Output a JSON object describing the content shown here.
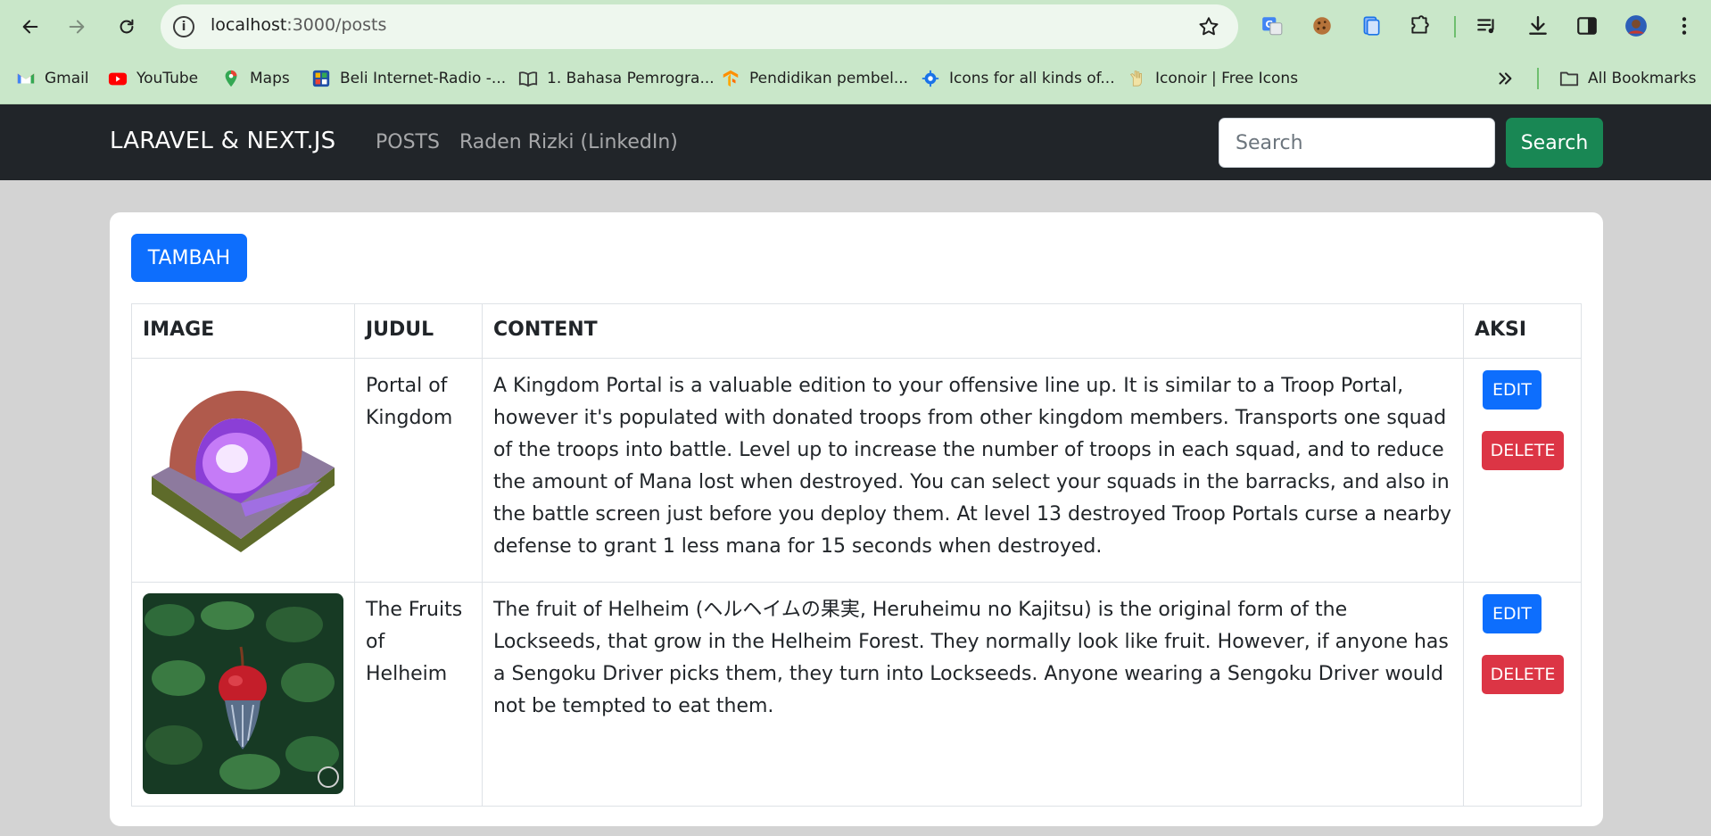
{
  "browser": {
    "url_host": "localhost",
    "url_path": ":3000/posts",
    "bookmarks": [
      {
        "label": "Gmail",
        "icon": "gmail-icon"
      },
      {
        "label": "YouTube",
        "icon": "youtube-icon"
      },
      {
        "label": "Maps",
        "icon": "maps-icon"
      },
      {
        "label": "Beli Internet-Radio -...",
        "icon": "radio-icon"
      },
      {
        "label": "1. Bahasa Pemrogra...",
        "icon": "book-icon"
      },
      {
        "label": "Pendidikan pembel...",
        "icon": "tensorflow-icon"
      },
      {
        "label": "Icons for all kinds of...",
        "icon": "icons-site-icon"
      },
      {
        "label": "Iconoir | Free Icons",
        "icon": "iconoir-icon"
      }
    ],
    "all_bookmarks": "All Bookmarks"
  },
  "navbar": {
    "brand": "LARAVEL & NEXT.JS",
    "links": [
      "POSTS",
      "Raden Rizki (LinkedIn)"
    ],
    "search_placeholder": "Search",
    "search_button": "Search"
  },
  "main": {
    "add_button": "TAMBAH",
    "columns": [
      "IMAGE",
      "JUDUL",
      "CONTENT",
      "AKSI"
    ],
    "rows": [
      {
        "judul": "Portal of Kingdom",
        "content": "A Kingdom Portal is a valuable edition to your offensive line up. It is similar to a Troop Portal, however it's populated with donated troops from other kingdom members. Transports one squad of the troops into battle. Level up to increase the number of troops in each squad, and to reduce the amount of Mana lost when destroyed. You can select your squads in the barracks, and also in the battle screen just before you deploy them. At level 13 destroyed Troop Portals curse a nearby defense to grant 1 less mana for 15 seconds when destroyed.",
        "edit": "EDIT",
        "delete": "DELETE"
      },
      {
        "judul": "The Fruits of Helheim",
        "content": "The fruit of Helheim (ヘルヘイムの果実, Heruheimu no Kajitsu) is the original form of the Lockseeds, that grow in the Helheim Forest. They normally look like fruit. However, if anyone has a Sengoku Driver picks them, they turn into Lockseeds. Anyone wearing a Sengoku Driver would not be tempted to eat them.",
        "edit": "EDIT",
        "delete": "DELETE"
      }
    ]
  },
  "colors": {
    "chrome": "#c9e7c9",
    "navbar": "#212529",
    "primary": "#0d6efd",
    "success": "#198754",
    "danger": "#dc3545",
    "page_bg": "#d3d3d3"
  }
}
